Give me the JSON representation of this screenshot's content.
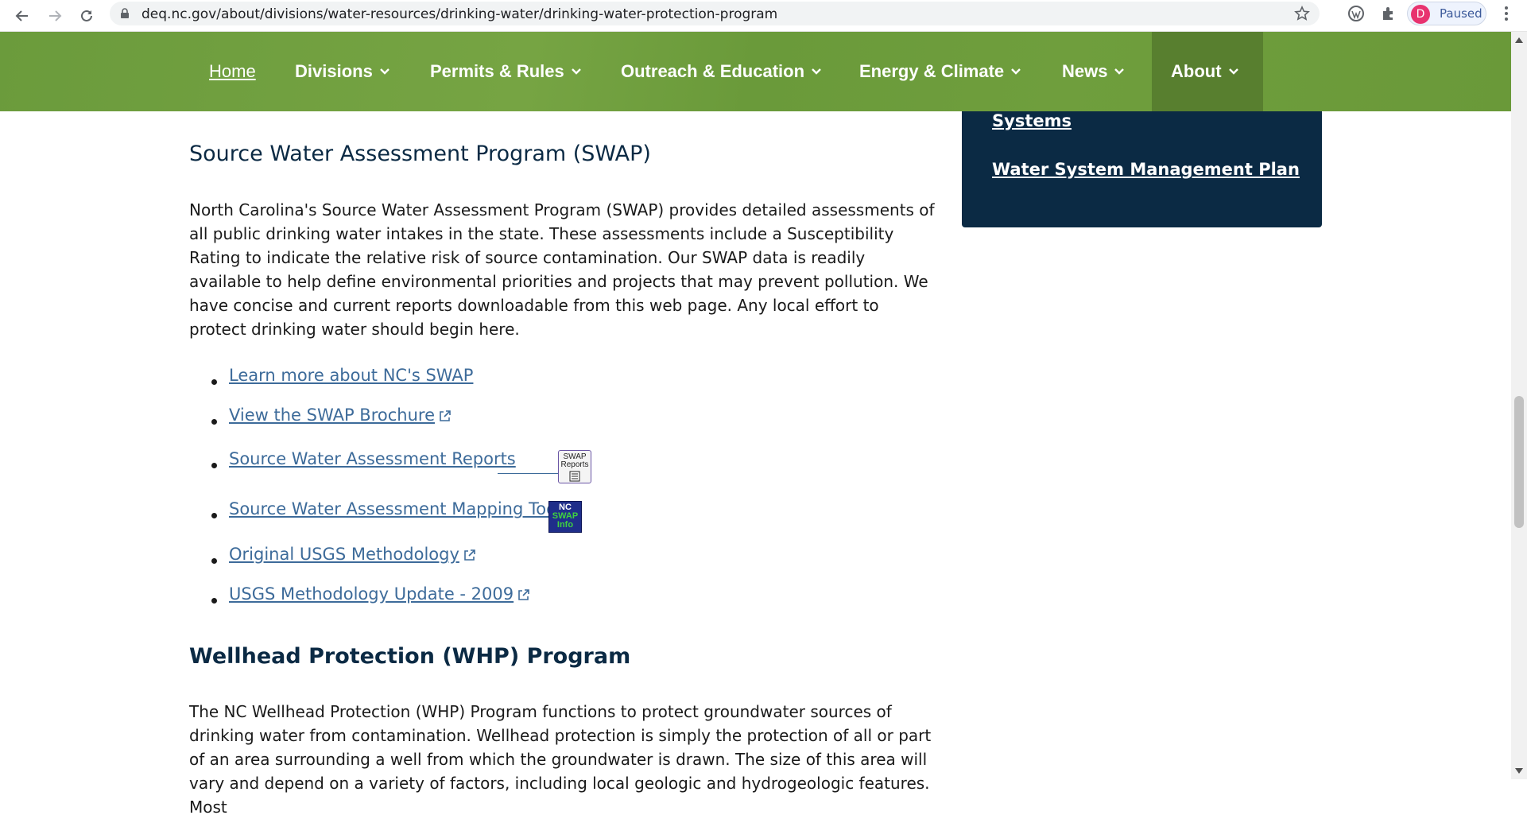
{
  "browser": {
    "url": "deq.nc.gov/about/divisions/water-resources/drinking-water/drinking-water-protection-program",
    "profile_initial": "D",
    "profile_status": "Paused",
    "icons": [
      "back-icon",
      "forward-icon",
      "reload-icon",
      "lock-icon",
      "star-icon",
      "wordpress-icon",
      "puzzle-icon",
      "menu-dots-icon"
    ]
  },
  "nav": {
    "items": [
      {
        "label": "Home"
      },
      {
        "label": "Divisions"
      },
      {
        "label": "Permits & Rules"
      },
      {
        "label": "Outreach & Education"
      },
      {
        "label": "Energy & Climate"
      },
      {
        "label": "News"
      },
      {
        "label": "About"
      }
    ]
  },
  "sidebar": {
    "links": [
      {
        "label": "Systems"
      },
      {
        "label": "Water System Management Plan"
      }
    ]
  },
  "swap": {
    "title": "Source Water Assessment Program (SWAP)",
    "body": "North Carolina's Source Water Assessment Program (SWAP) provides detailed assessments of all public drinking water intakes in the state. These assessments include a Susceptibility Rating to indicate the relative risk of source contamination. Our SWAP data is readily available to help define environmental priorities and projects that may prevent pollution. We have concise and current reports downloadable from this web page. Any local effort to protect drinking water should begin here.",
    "links": [
      {
        "label": "Learn more about NC's SWAP"
      },
      {
        "label": "View the SWAP Brochure"
      },
      {
        "label": "Source Water Assessment Reports"
      },
      {
        "label": "Source Water Assessment Mapping Tool"
      },
      {
        "label": "Original USGS Methodology"
      },
      {
        "label": "USGS Methodology Update - 2009"
      }
    ],
    "reports_badge": {
      "line1": "SWAP",
      "line2": "Reports"
    },
    "info_badge": {
      "line1": "NC",
      "line2": "SWAP",
      "line3": "Info"
    }
  },
  "whp": {
    "title": "Wellhead Protection (WHP) Program",
    "body": "The NC Wellhead Protection (WHP) Program functions to protect groundwater sources of drinking water from contamination. Wellhead protection is simply the protection of all or part of an area surrounding a well from which the groundwater is drawn. The size of this area will vary and depend on a variety of factors, including local geologic and hydrogeologic features. Most"
  },
  "colors": {
    "nav_green": "#6f9e3d",
    "nav_active": "#587f2f",
    "heading_navy": "#0b2a44",
    "link_blue": "#3d6b9a",
    "sidebar_navy": "#0b2a44"
  }
}
